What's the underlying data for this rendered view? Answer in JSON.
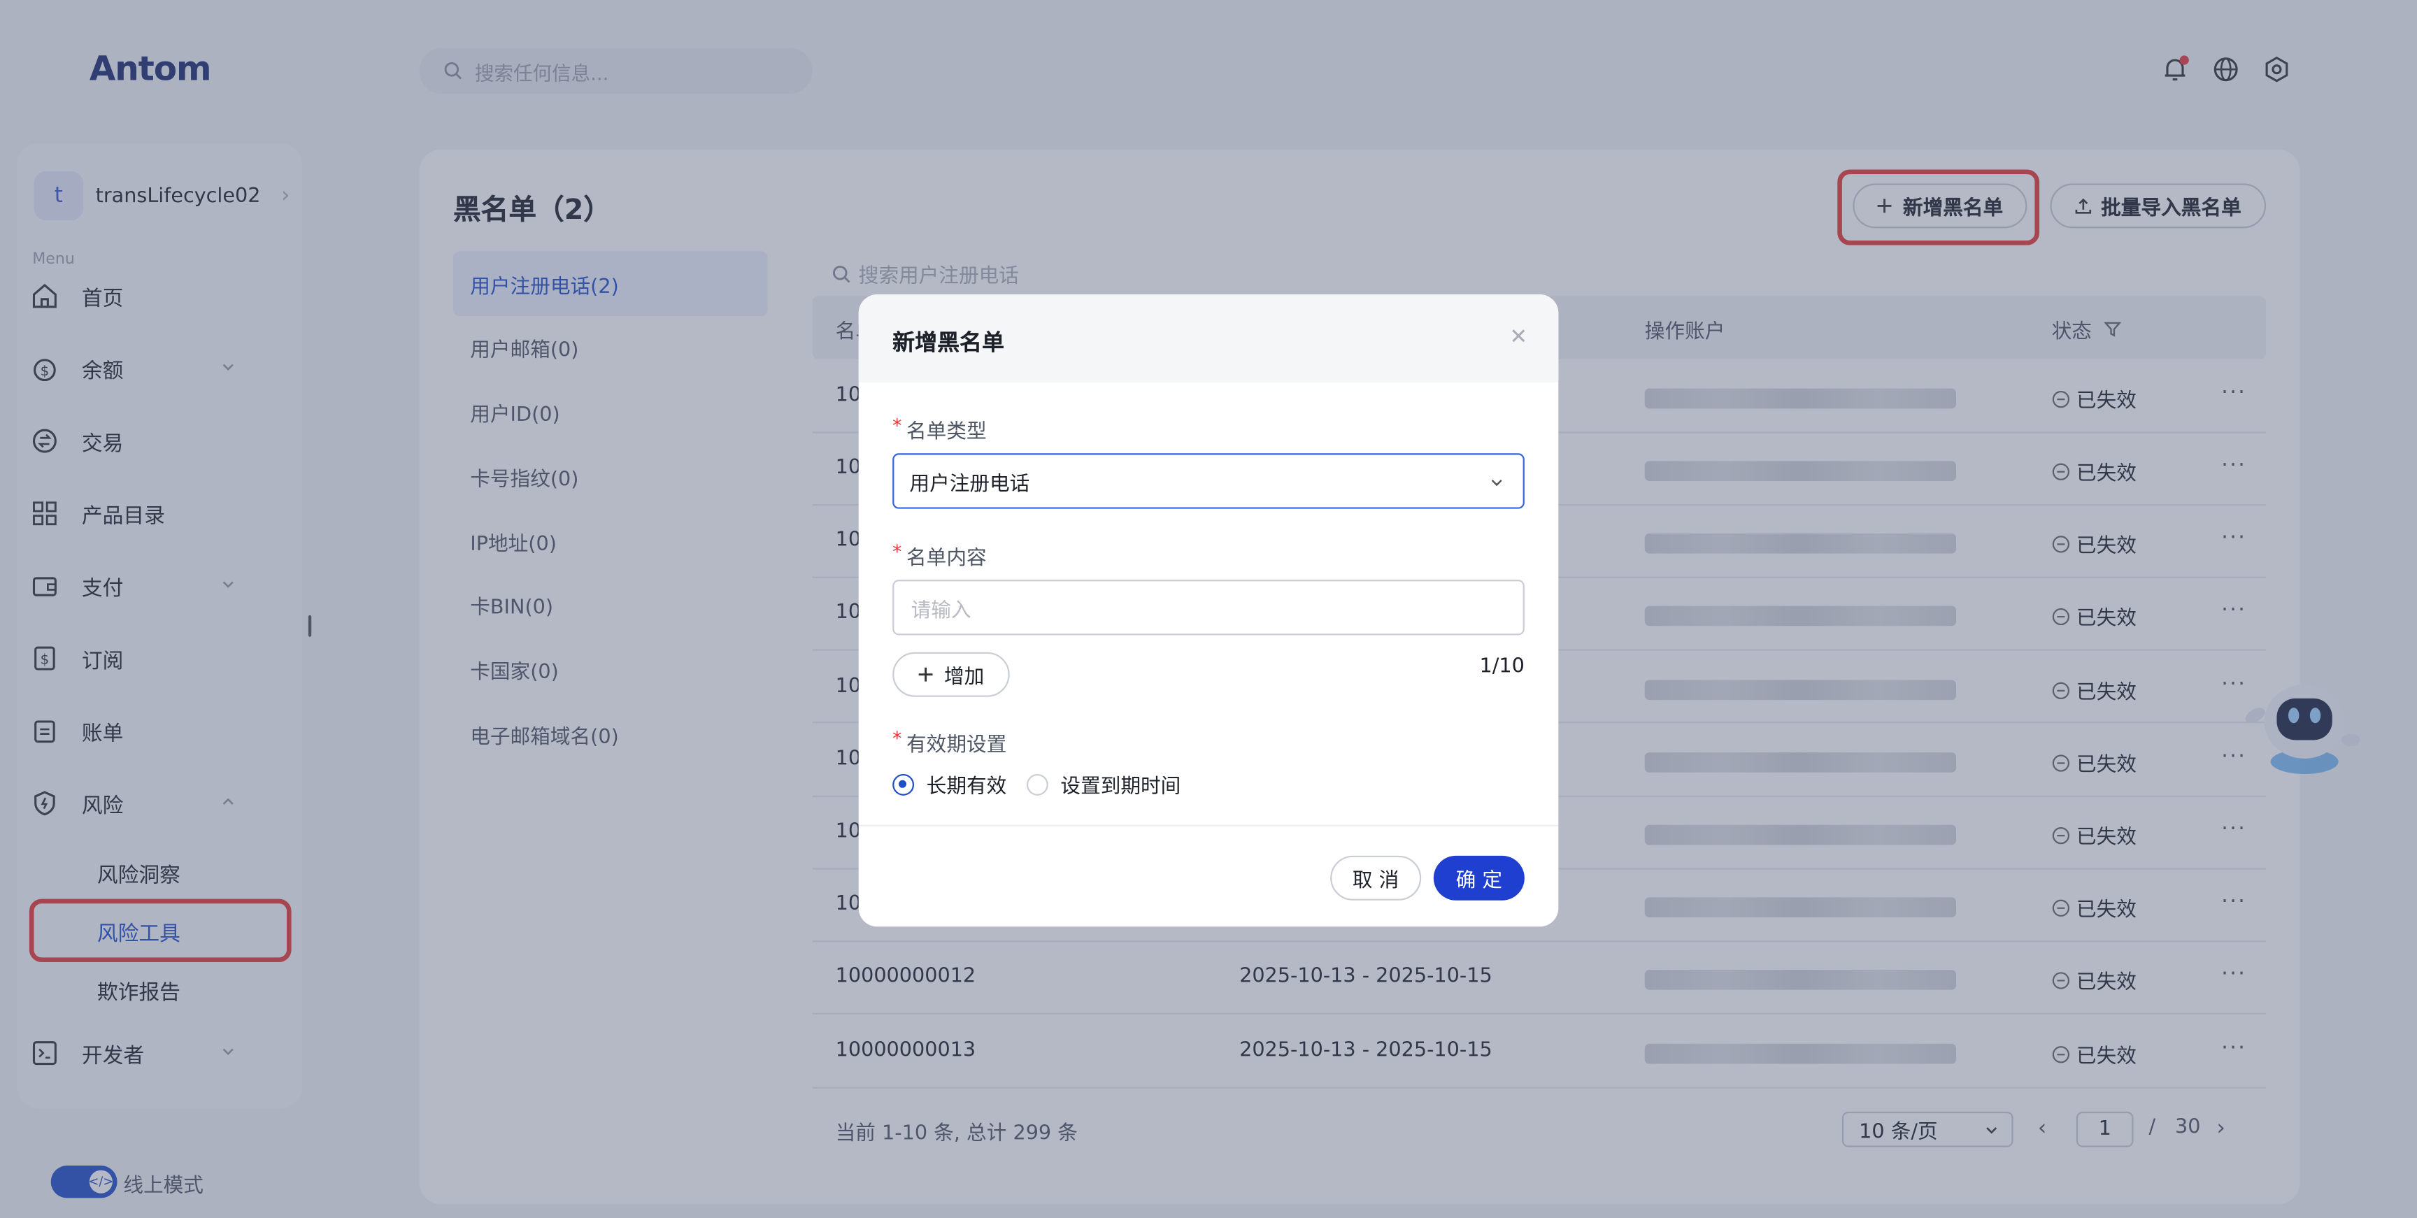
{
  "brand": {
    "logo": "Antom"
  },
  "header": {
    "search_placeholder": "搜索任何信息..."
  },
  "sidebar": {
    "account_initial": "t",
    "account_name": "transLifecycle02",
    "menu_label": "Menu",
    "items": [
      {
        "label": "首页"
      },
      {
        "label": "余额"
      },
      {
        "label": "交易"
      },
      {
        "label": "产品目录"
      },
      {
        "label": "支付"
      },
      {
        "label": "订阅"
      },
      {
        "label": "账单"
      },
      {
        "label": "风险"
      },
      {
        "label": "开发者"
      }
    ],
    "risk_sub": [
      {
        "label": "风险洞察"
      },
      {
        "label": "风险工具"
      },
      {
        "label": "欺诈报告"
      }
    ],
    "mode_label": "线上模式"
  },
  "main": {
    "title": "黑名单（2）",
    "add_button": "新增黑名单",
    "import_button": "批量导入黑名单",
    "categories": [
      {
        "label": "用户注册电话(2)"
      },
      {
        "label": "用户邮箱(0)"
      },
      {
        "label": "用户ID(0)"
      },
      {
        "label": "卡号指纹(0)"
      },
      {
        "label": "IP地址(0)"
      },
      {
        "label": "卡BIN(0)"
      },
      {
        "label": "卡国家(0)"
      },
      {
        "label": "电子邮箱域名(0)"
      }
    ],
    "table_search_placeholder": "搜索用户注册电话",
    "columns": {
      "name": "名单",
      "account": "操作账户",
      "status": "状态"
    },
    "rows": [
      {
        "name": "10",
        "period": "",
        "status": "已失效"
      },
      {
        "name": "10",
        "period": "",
        "status": "已失效"
      },
      {
        "name": "10",
        "period": "",
        "status": "已失效"
      },
      {
        "name": "10",
        "period": "",
        "status": "已失效"
      },
      {
        "name": "10",
        "period": "",
        "status": "已失效"
      },
      {
        "name": "10",
        "period": "",
        "status": "已失效"
      },
      {
        "name": "10",
        "period": "",
        "status": "已失效"
      },
      {
        "name": "10",
        "period": "",
        "status": "已失效"
      },
      {
        "name": "10000000012",
        "period": "2025-10-13 - 2025-10-15",
        "status": "已失效"
      },
      {
        "name": "10000000013",
        "period": "2025-10-13 - 2025-10-15",
        "status": "已失效"
      }
    ],
    "more_label": "···",
    "pagination": {
      "info": "当前 1-10 条, 总计 299 条",
      "page_size": "10 条/页",
      "current": "1",
      "sep": "/",
      "total": "30"
    }
  },
  "modal": {
    "title": "新增黑名单",
    "type_label": "名单类型",
    "type_value": "用户注册电话",
    "content_label": "名单内容",
    "content_placeholder": "请输入",
    "add_label": "增加",
    "count": "1/10",
    "validity_label": "有效期设置",
    "option_long": "长期有效",
    "option_expire": "设置到期时间",
    "cancel": "取 消",
    "ok": "确 定",
    "required_mark": "*"
  },
  "colors": {
    "accent": "#1f4fc7",
    "highlight": "#e53935",
    "primary_button": "#1f3fd0"
  }
}
